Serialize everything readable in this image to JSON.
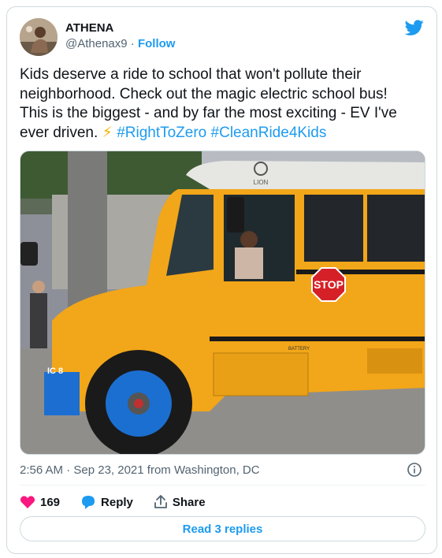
{
  "author": {
    "name": "ATHENA",
    "handle": "@Athenax9",
    "separator": "·",
    "follow_label": "Follow"
  },
  "tweet": {
    "text_lines": [
      "Kids deserve a ride to school that won't pollute their",
      "neighborhood. Check out the magic electric school bus!",
      "This is the biggest - and by far the most exciting - EV I've",
      "ever driven."
    ],
    "emoji": "⚡",
    "hashtags": [
      "#RightToZero",
      "#CleanRide4Kids"
    ]
  },
  "media": {
    "bus_brand": "LION",
    "stop_sign": "STOP",
    "panel_label": "BATTERY",
    "side_label": "IC 8"
  },
  "meta": {
    "timestamp": "2:56 AM · Sep 23, 2021 from Washington, DC"
  },
  "actions": {
    "like_count": "169",
    "reply_label": "Reply",
    "share_label": "Share"
  },
  "read_replies_label": "Read 3 replies",
  "colors": {
    "accent": "#1d9bf0",
    "like": "#f91880",
    "bus_yellow": "#f2a619",
    "wheel_blue": "#1b6fd1"
  },
  "icons": [
    "twitter-bird-icon",
    "info-icon",
    "heart-icon",
    "reply-icon",
    "share-icon",
    "lightning-emoji"
  ]
}
